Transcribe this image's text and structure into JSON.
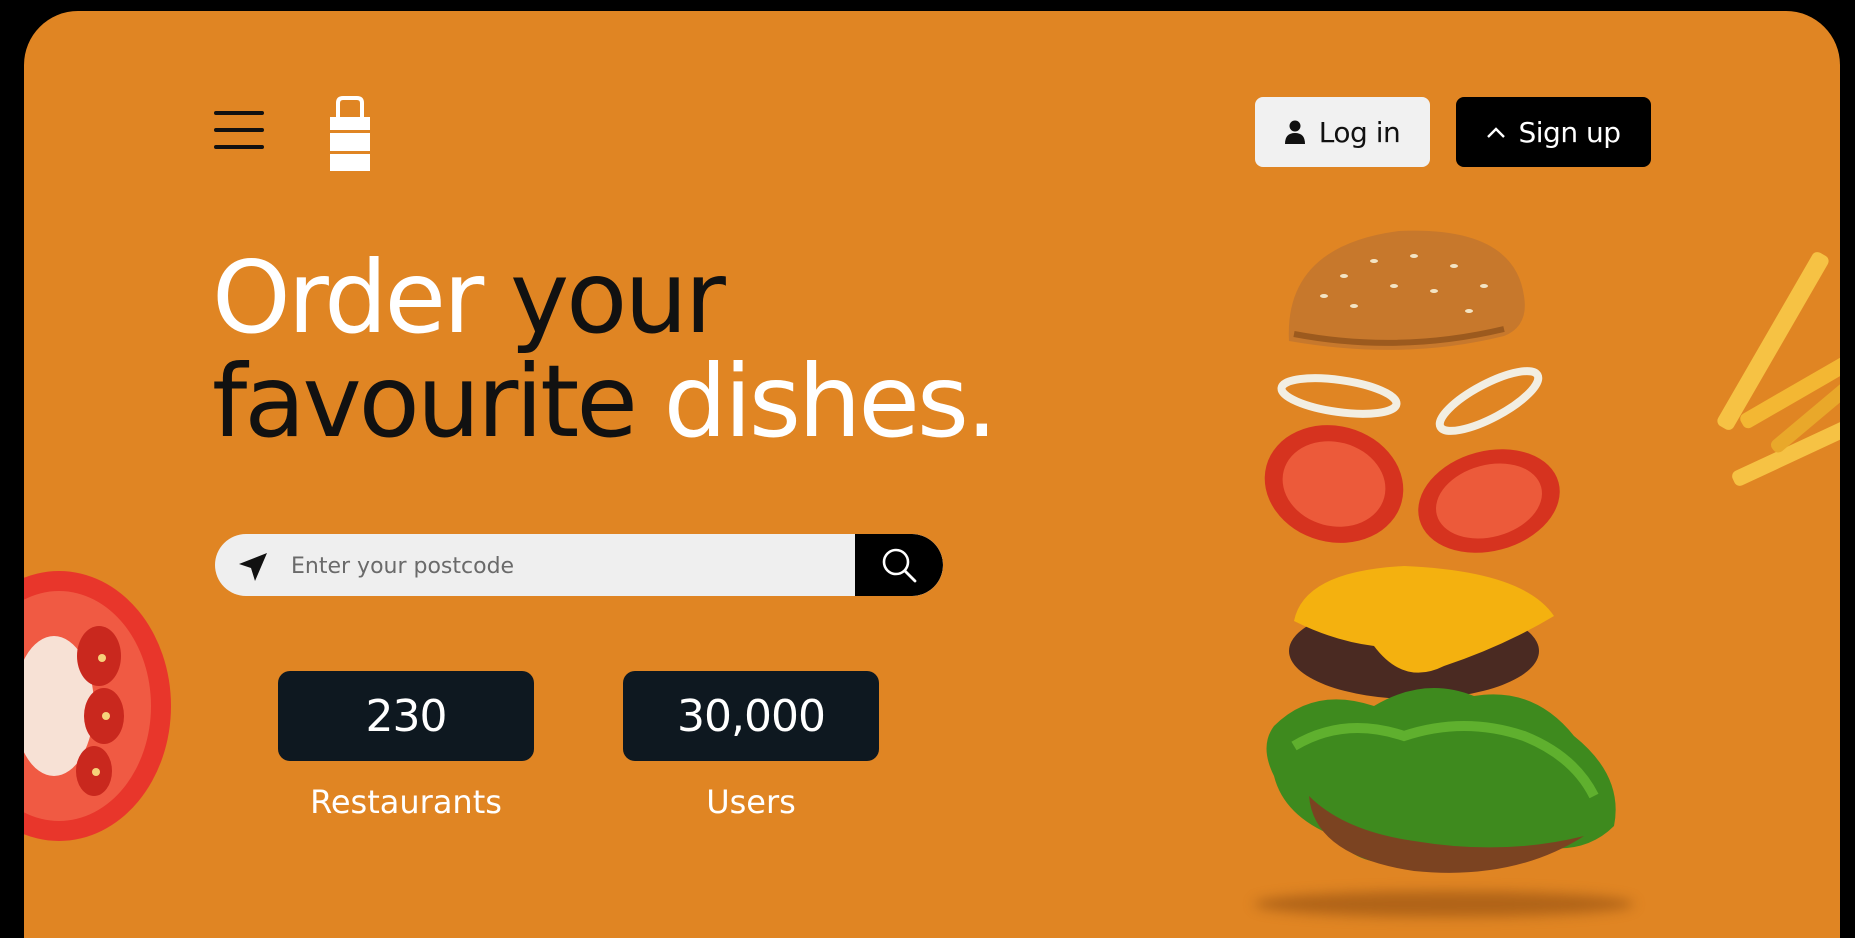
{
  "header": {
    "menu_icon": "hamburger-menu-icon",
    "logo_icon": "shopping-bag-logo-icon",
    "login_label": "Log in",
    "signup_label": "Sign up"
  },
  "hero": {
    "line1_white": "Order",
    "line1_black": "your",
    "line2_black": "favourite",
    "line2_white": "dishes."
  },
  "search": {
    "placeholder": "Enter your postcode",
    "value": ""
  },
  "stats": [
    {
      "value": "230",
      "label": "Restaurants"
    },
    {
      "value": "30,000",
      "label": "Users"
    }
  ],
  "colors": {
    "background": "#E08523",
    "dark": "#0E1820",
    "light_button": "#F1F1F1"
  }
}
